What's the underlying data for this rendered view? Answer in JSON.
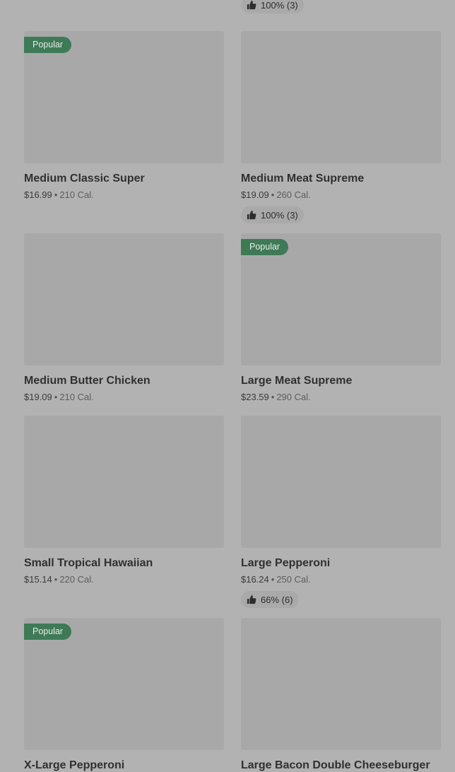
{
  "top_rating": {
    "text": "100% (3)"
  },
  "products": [
    {
      "name": "Medium Classic Super",
      "price": "$16.99",
      "calories": "210 Cal.",
      "badge": "Popular",
      "rating": ""
    },
    {
      "name": "Medium Meat Supreme",
      "price": "$19.09",
      "calories": "260 Cal.",
      "badge": "",
      "rating": "100% (3)"
    },
    {
      "name": "Medium Butter Chicken",
      "price": "$19.09",
      "calories": "210 Cal.",
      "badge": "",
      "rating": ""
    },
    {
      "name": "Large Meat Supreme",
      "price": "$23.59",
      "calories": "290 Cal.",
      "badge": "Popular",
      "rating": ""
    },
    {
      "name": "Small Tropical Hawaiian",
      "price": "$15.14",
      "calories": "220 Cal.",
      "badge": "",
      "rating": ""
    },
    {
      "name": "Large Pepperoni",
      "price": "$16.24",
      "calories": "250 Cal.",
      "badge": "",
      "rating": "66% (6)"
    },
    {
      "name": "X-Large Pepperoni",
      "price": "",
      "calories": "",
      "badge": "Popular",
      "rating": ""
    },
    {
      "name": "Large Bacon Double Cheeseburger",
      "price": "",
      "calories": "",
      "badge": "",
      "rating": ""
    }
  ],
  "separator": "•",
  "icons": {
    "rating": "thumbs-up-icon"
  },
  "colors": {
    "badge_bg": "#3f7a57",
    "page_bg": "#b2b2b2",
    "image_placeholder": "#a8a8a8"
  }
}
